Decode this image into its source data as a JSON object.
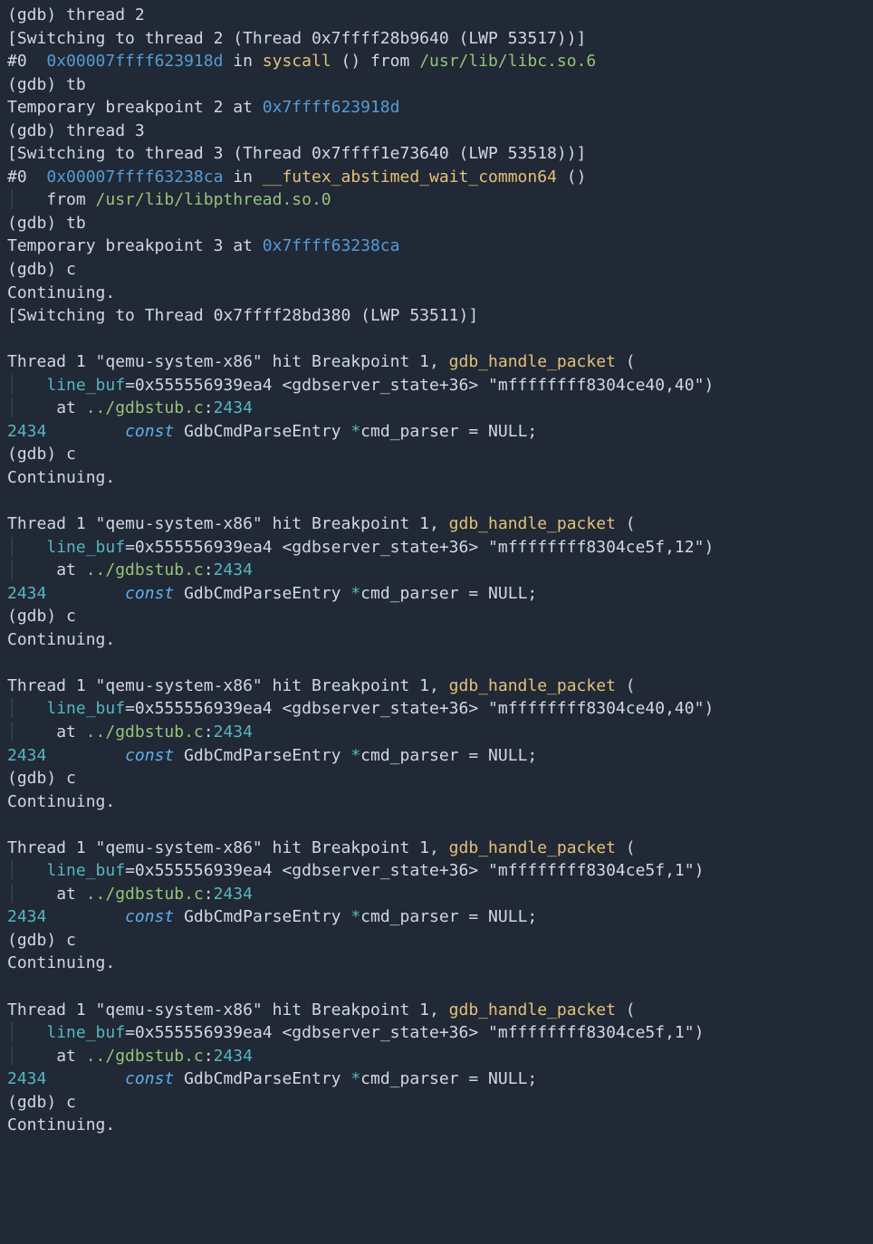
{
  "prompt": "(gdb) ",
  "cmd": {
    "thread2": "thread 2",
    "thread3": "thread 3",
    "tb": "tb",
    "c": "c"
  },
  "sw": {
    "t2": "[Switching to thread 2 (Thread 0x7ffff28b9640 (LWP 53517))]",
    "t3": "[Switching to thread 3 (Thread 0x7ffff1e73640 (LWP 53518))]",
    "main": "[Switching to Thread 0x7ffff28bd380 (LWP 53511)]"
  },
  "continuing": "Continuing.",
  "frame0": {
    "addr2": "0x00007ffff623918d",
    "fn2": "syscall",
    "after_fn2": " () from ",
    "path2": "/usr/lib/libc.so.6",
    "addr3": "0x00007ffff63238ca",
    "fn3": "__futex_abstimed_wait_common64",
    "after_fn3": " ()",
    "from_lbl": "   from ",
    "path3": "/usr/lib/libpthread.so.0"
  },
  "tbp": {
    "l2a": "Temporary breakpoint 2 at ",
    "l2b": "0x7ffff623918d",
    "l3a": "Temporary breakpoint 3 at ",
    "l3b": "0x7ffff63238ca"
  },
  "hit": {
    "lead": "Thread 1 \"qemu-system-x86\" hit Breakpoint 1, ",
    "fn": "gdb_handle_packet",
    "open": " (",
    "line_buf": "line_buf",
    "eq": "=0x555556939ea4 <gdbserver_state+36> ",
    "q1": "\"mffffffff8304ce40,40\"",
    "q2": "\"mffffffff8304ce5f,12\"",
    "q4": "\"mffffffff8304ce5f,1\"",
    "close": ")",
    "at": "    at ",
    "path": "../gdbstub.c",
    "colon": ":",
    "lineno": "2434"
  },
  "src": {
    "lineno": "2434",
    "pad": "        ",
    "kw": "const",
    "sp": " ",
    "type": "GdbCmdParseEntry ",
    "star": "*",
    "rest": "cmd_parser = NULL;"
  },
  "labels": {
    "f0": "#0  ",
    "in": " in ",
    "indent": "    ",
    "guide": "│"
  }
}
